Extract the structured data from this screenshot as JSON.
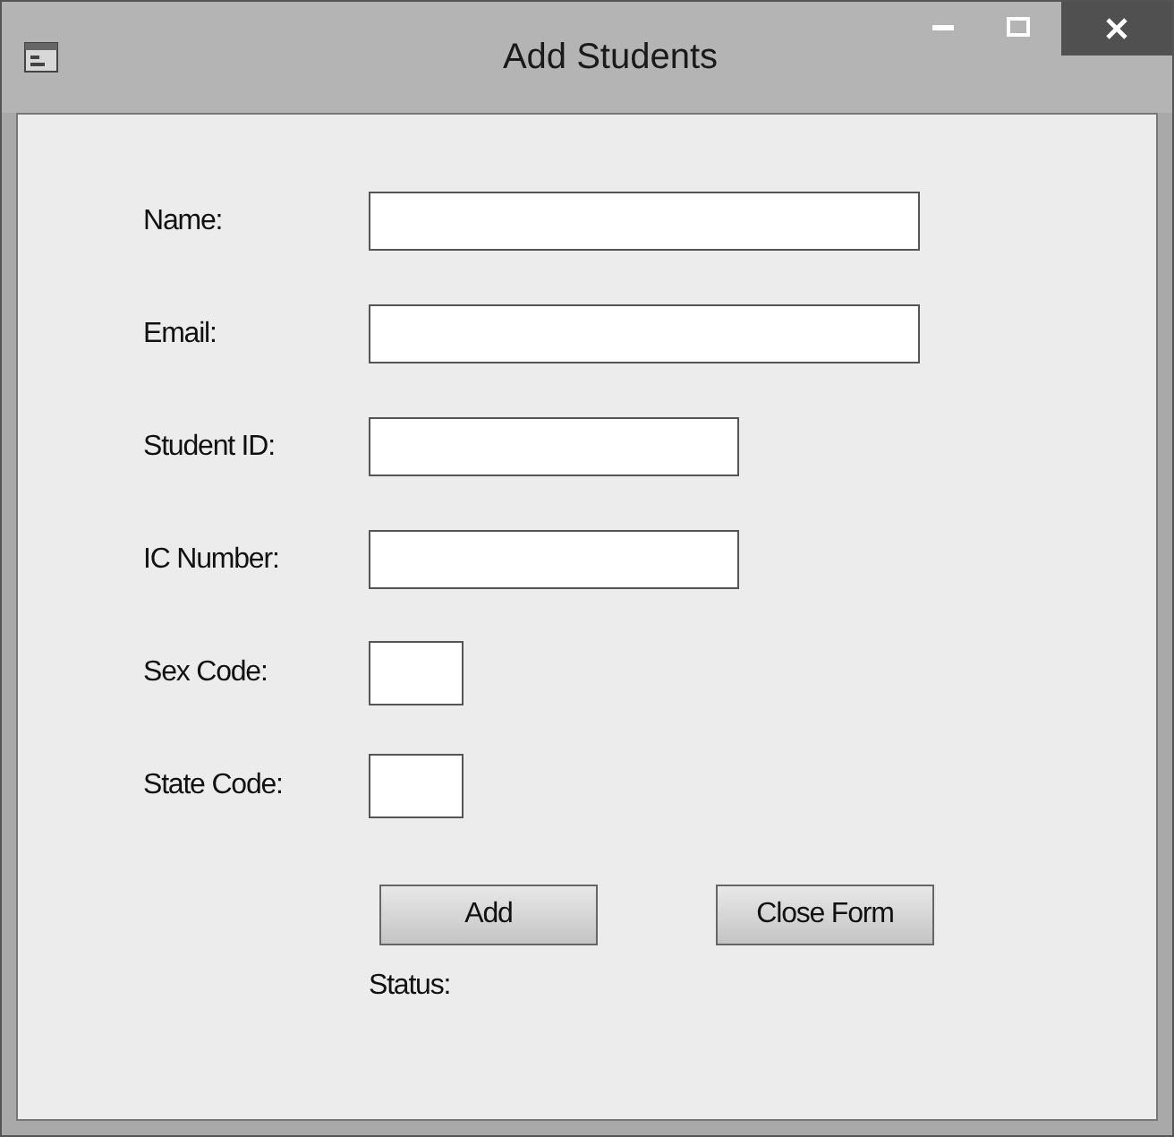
{
  "window": {
    "title": "Add Students"
  },
  "fields": [
    {
      "label": "Name:",
      "kind": "wide"
    },
    {
      "label": "Email:",
      "kind": "wide"
    },
    {
      "label": "Student ID:",
      "kind": "medium"
    },
    {
      "label": "IC Number:",
      "kind": "medium"
    },
    {
      "label": "Sex Code:",
      "kind": "short"
    },
    {
      "label": "State Code:",
      "kind": "short"
    }
  ],
  "buttons": [
    "Add",
    "Close Form"
  ],
  "status": {
    "label": "Status:"
  }
}
